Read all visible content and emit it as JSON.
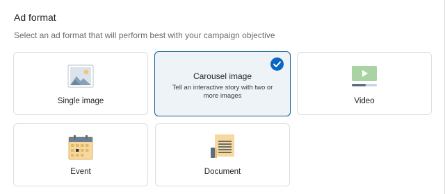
{
  "section": {
    "title": "Ad format",
    "subtitle": "Select an ad format that will perform best with your campaign objective"
  },
  "formats": [
    {
      "label": "Single image",
      "icon": "image-icon",
      "selected": false
    },
    {
      "label": "Carousel image",
      "description": "Tell an interactive story with two or more images",
      "icon": "",
      "selected": true
    },
    {
      "label": "Video",
      "icon": "video-icon",
      "selected": false
    },
    {
      "label": "Event",
      "icon": "calendar-icon",
      "selected": false
    },
    {
      "label": "Document",
      "icon": "document-icon",
      "selected": false
    }
  ],
  "colors": {
    "accent": "#0a66c2",
    "selected_border": "#0a5d95",
    "selected_bg": "#eef3f8",
    "card_border": "#d9dee3"
  }
}
